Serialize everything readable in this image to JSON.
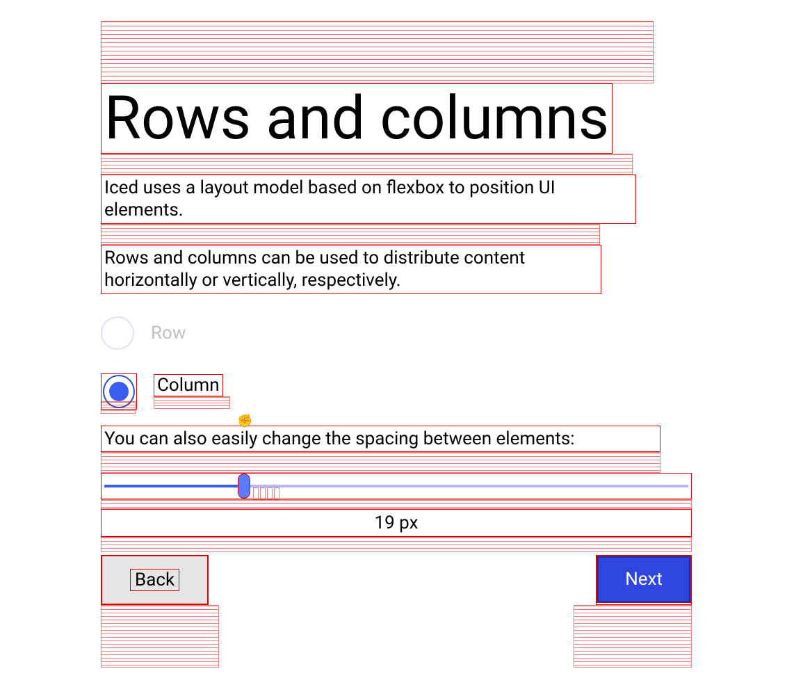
{
  "title": "Rows and columns",
  "paragraph1": "Iced uses a layout model based on flexbox to position UI elements.",
  "paragraph2": "Rows and columns can be used to distribute content horizontally or vertically, respectively.",
  "radio": {
    "row_label": "Row",
    "column_label": "Column",
    "selected": "column"
  },
  "spacing_label": "You can also easily change the spacing between elements:",
  "slider": {
    "value": 19,
    "min": 0,
    "max": 80,
    "display": "19 px"
  },
  "buttons": {
    "back": "Back",
    "next": "Next"
  }
}
